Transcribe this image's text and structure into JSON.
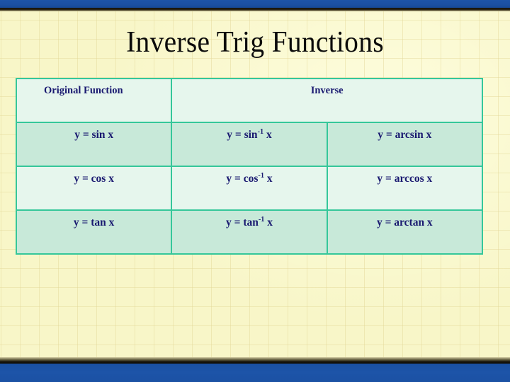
{
  "slide": {
    "title": "Inverse Trig Functions",
    "accent_border": "#35c79a",
    "header_bg": "#e6f6ed",
    "row_shade_bg": "#c8e9d9",
    "text_color": "#191970",
    "background": "#f8f6c8",
    "chrome_bar_color": "#1d54a8"
  },
  "table": {
    "headers": {
      "original": "Original Function",
      "inverse": "Inverse"
    },
    "rows": [
      {
        "original": "y = sin x",
        "inverse_notation_base": "y = sin",
        "inverse_notation_exp": "-1",
        "inverse_notation_tail": " x",
        "inverse_named": "y = arcsin x"
      },
      {
        "original": "y = cos x",
        "inverse_notation_base": "y = cos",
        "inverse_notation_exp": "-1",
        "inverse_notation_tail": " x",
        "inverse_named": "y = arccos x"
      },
      {
        "original": "y = tan x",
        "inverse_notation_base": "y = tan",
        "inverse_notation_exp": "-1",
        "inverse_notation_tail": " x",
        "inverse_named": "y = arctan x"
      }
    ]
  }
}
